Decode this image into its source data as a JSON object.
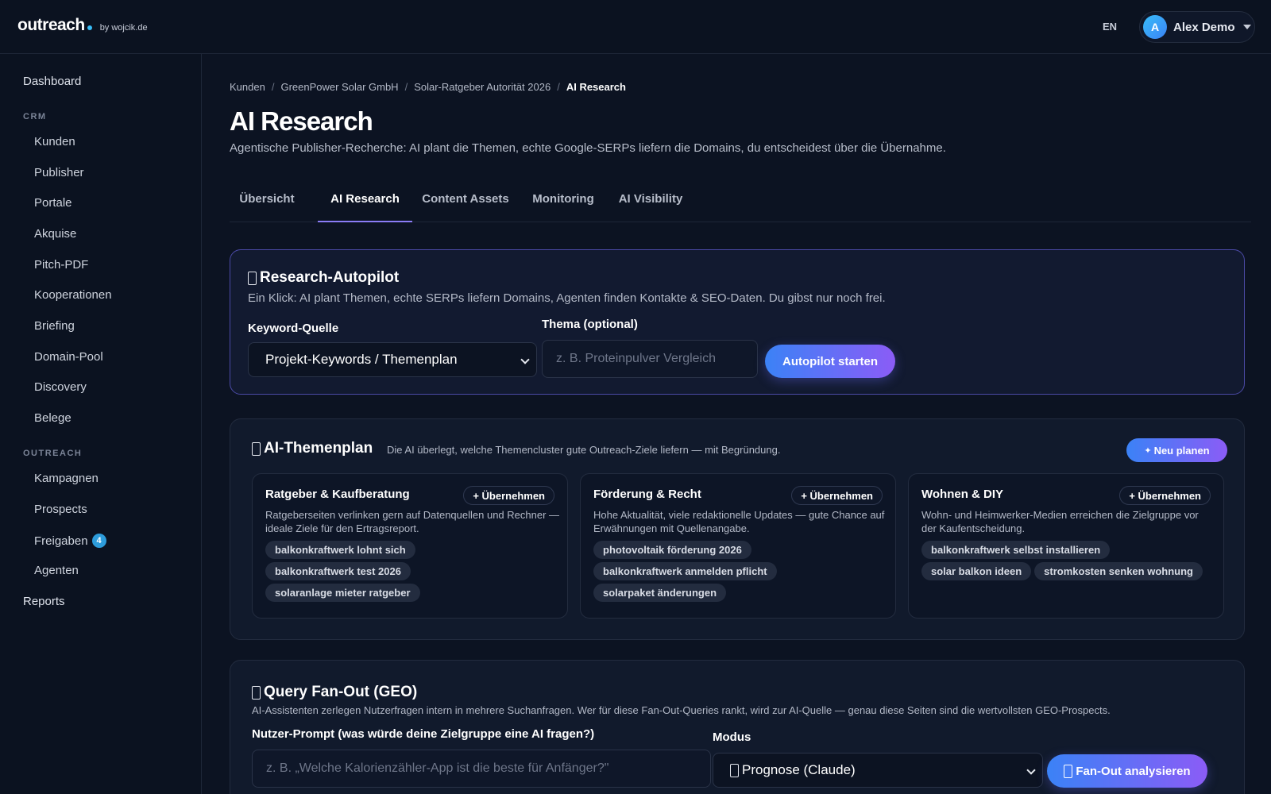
{
  "header": {
    "logo_word": "outreach",
    "logo_by": "by wojcik.de",
    "lang": "EN",
    "user_initial": "A",
    "user_name": "Alex Demo"
  },
  "sidebar": {
    "dashboard": "Dashboard",
    "crm_label": "CRM",
    "crm_items": [
      "Kunden",
      "Publisher",
      "Portale",
      "Akquise",
      "Pitch-PDF",
      "Kooperationen",
      "Briefing",
      "Domain-Pool",
      "Discovery",
      "Belege"
    ],
    "outreach_label": "OUTREACH",
    "outreach_items": [
      "Kampagnen",
      "Prospects",
      "Freigaben",
      "Agenten"
    ],
    "freigaben_badge": "4",
    "reports": "Reports"
  },
  "breadcrumb": [
    "Kunden",
    "GreenPower Solar GmbH",
    "Solar-Ratgeber Autorität 2026",
    "AI Research"
  ],
  "page": {
    "title": "AI Research",
    "subtitle": "Agentische Publisher-Recherche: AI plant die Themen, echte Google-SERPs liefern die Domains, du entscheidest über die Übernahme."
  },
  "tabs": [
    "Übersicht",
    "AI Research",
    "Content Assets",
    "Monitoring",
    "AI Visibility"
  ],
  "active_tab": "AI Research",
  "autopilot": {
    "title": "Research-Autopilot",
    "desc": "Ein Klick: AI plant Themen, echte SERPs liefern Domains, Agenten finden Kontakte & SEO-Daten. Du gibst nur noch frei.",
    "keyword_label": "Keyword-Quelle",
    "keyword_value": "Projekt-Keywords / Themenplan",
    "topic_label": "Thema (optional)",
    "topic_placeholder": "z. B. Proteinpulver Vergleich",
    "start_button": "Autopilot starten"
  },
  "themenplan": {
    "title": "AI-Themenplan",
    "desc": "Die AI überlegt, welche Themencluster gute Outreach-Ziele liefern — mit Begründung.",
    "replan_button": "Neu planen",
    "adopt_label": "+ Übernehmen",
    "topics": [
      {
        "name": "Ratgeber & Kaufberatung",
        "desc": "Ratgeberseiten verlinken gern auf Datenquellen und Rechner — ideale Ziele für den Ertragsreport.",
        "keywords": [
          "balkonkraftwerk lohnt sich",
          "balkonkraftwerk test 2026",
          "solaranlage mieter ratgeber"
        ]
      },
      {
        "name": "Förderung & Recht",
        "desc": "Hohe Aktualität, viele redaktionelle Updates — gute Chance auf Erwähnungen mit Quellenangabe.",
        "keywords": [
          "photovoltaik förderung 2026",
          "balkonkraftwerk anmelden pflicht",
          "solarpaket änderungen"
        ]
      },
      {
        "name": "Wohnen & DIY",
        "desc": "Wohn- und Heimwerker-Medien erreichen die Zielgruppe vor der Kaufentscheidung.",
        "keywords": [
          "balkonkraftwerk selbst installieren",
          "solar balkon ideen",
          "stromkosten senken wohnung"
        ]
      }
    ]
  },
  "fanout": {
    "title": "Query Fan-Out (GEO)",
    "desc": "AI-Assistenten zerlegen Nutzerfragen intern in mehrere Suchanfragen. Wer für diese Fan-Out-Queries rankt, wird zur AI-Quelle — genau diese Seiten sind die wertvollsten GEO-Prospects.",
    "prompt_label": "Nutzer-Prompt (was würde deine Zielgruppe eine AI fragen?)",
    "prompt_placeholder": "z. B. „Welche Kalorienzähler-App ist die beste für Anfänger?\"",
    "mode_label": "Modus",
    "mode_value": "Prognose (Claude)",
    "analyze_button": "Fan-Out analysieren"
  }
}
